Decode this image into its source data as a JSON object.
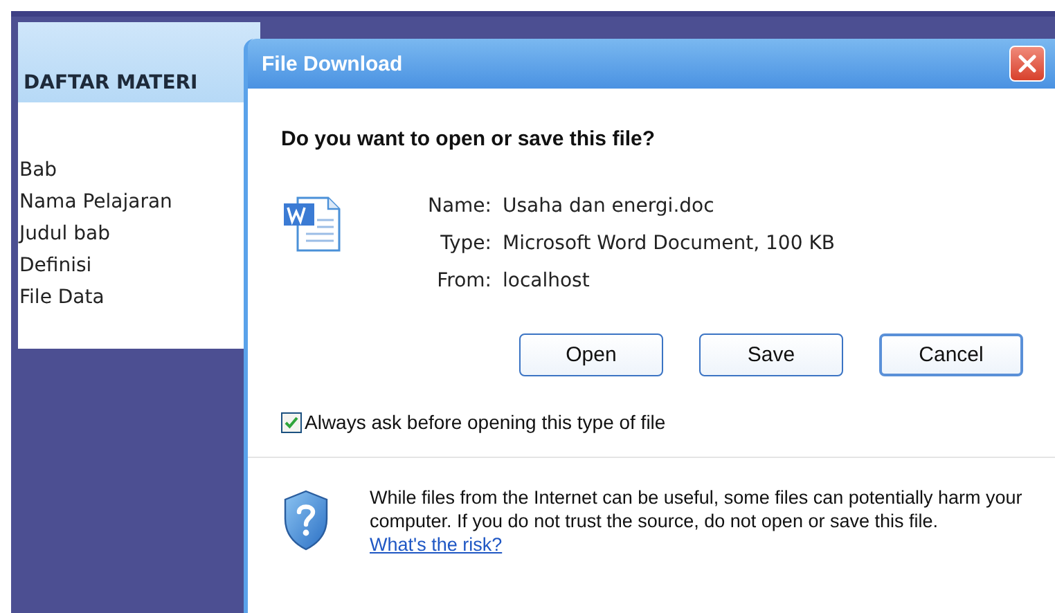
{
  "sidebar": {
    "title": "DAFTAR MATERI",
    "items": [
      "Bab",
      "Nama Pelajaran",
      "Judul bab",
      "Definisi",
      "File Data"
    ]
  },
  "dialog": {
    "title": "File Download",
    "question": "Do you want to open or save this file?",
    "fields": [
      {
        "label": "Name:",
        "value": "Usaha dan energi.doc"
      },
      {
        "label": "Type:",
        "value": "Microsoft Word Document, 100 KB"
      },
      {
        "label": "From:",
        "value": "localhost"
      }
    ],
    "buttons": [
      "Open",
      "Save",
      "Cancel"
    ],
    "always_ask": {
      "label": "Always ask before opening this type of file",
      "checked": true
    },
    "warning": {
      "text": "While files from the Internet can be useful, some files can potentially harm your computer. If you do not trust the source, do not open or save this file.",
      "link": "What's the risk?"
    }
  }
}
